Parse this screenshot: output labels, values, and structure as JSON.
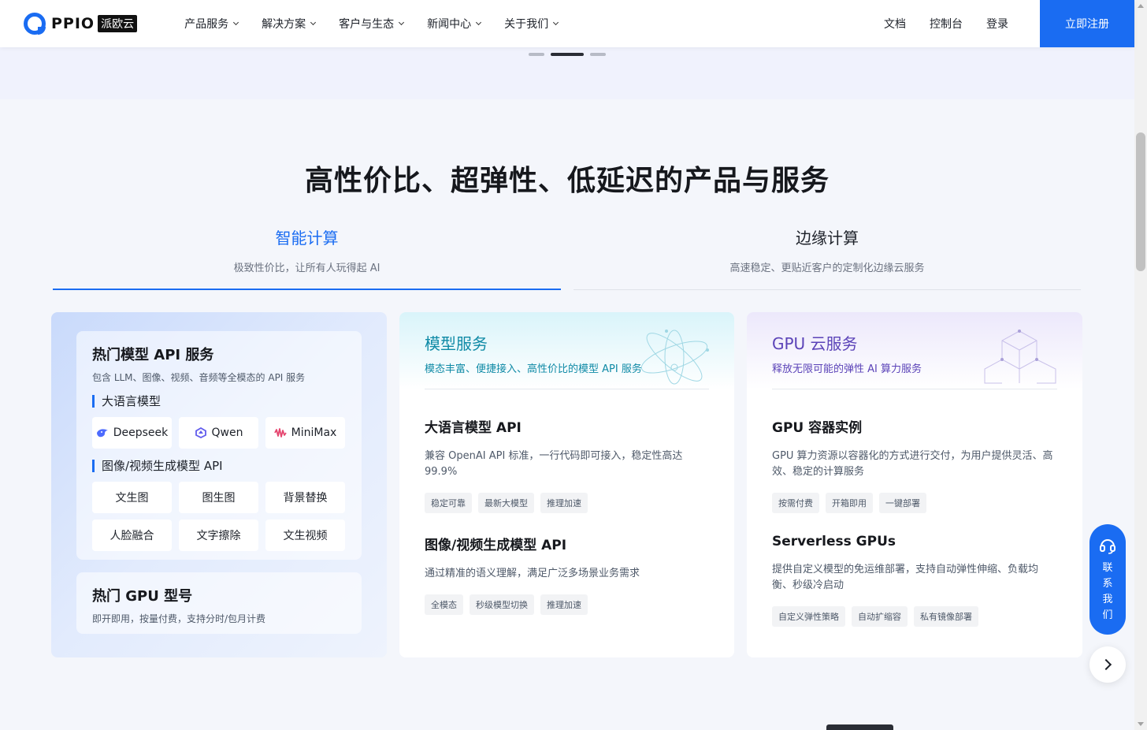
{
  "header": {
    "logo_text": "PPIO",
    "logo_cn": "派欧云",
    "nav": [
      "产品服务",
      "解决方案",
      "客户与生态",
      "新闻中心",
      "关于我们"
    ],
    "docs": "文档",
    "console": "控制台",
    "login": "登录",
    "signup": "立即注册"
  },
  "section": {
    "title": "高性价比、超弹性、低延迟的产品与服务"
  },
  "tabs": [
    {
      "title": "智能计算",
      "sub": "极致性价比，让所有人玩得起 AI"
    },
    {
      "title": "边缘计算",
      "sub": "高速稳定、更贴近客户的定制化边缘云服务"
    }
  ],
  "hot": {
    "title": "热门模型 API 服务",
    "sub": "包含 LLM、图像、视频、音频等全模态的 API 服务",
    "llm_label": "大语言模型",
    "llm_models": [
      "Deepseek",
      "Qwen",
      "MiniMax"
    ],
    "img_label": "图像/视频生成模型 API",
    "img_items": [
      "文生图",
      "图生图",
      "背景替换",
      "人脸融合",
      "文字擦除",
      "文生视频"
    ],
    "gpu_title": "热门 GPU 型号",
    "gpu_sub": "即开即用，按量付费，支持分时/包月计费"
  },
  "model_card": {
    "title": "模型服务",
    "sub": "模态丰富、便捷接入、高性价比的模型 API 服务",
    "services": [
      {
        "title": "大语言模型 API",
        "desc": "兼容 OpenAI API 标准，一行代码即可接入，稳定性高达 99.9%",
        "tags": [
          "稳定可靠",
          "最新大模型",
          "推理加速"
        ]
      },
      {
        "title": "图像/视频生成模型 API",
        "desc": "通过精准的语义理解，满足广泛多场景业务需求",
        "tags": [
          "全模态",
          "秒级模型切换",
          "推理加速"
        ]
      }
    ]
  },
  "gpu_card": {
    "title": "GPU 云服务",
    "sub": "释放无限可能的弹性 AI 算力服务",
    "services": [
      {
        "title": "GPU 容器实例",
        "desc": "GPU 算力资源以容器化的方式进行交付，为用户提供灵活、高效、稳定的计算服务",
        "tags": [
          "按需付费",
          "开箱即用",
          "一键部署"
        ]
      },
      {
        "title": "Serverless GPUs",
        "desc": "提供自定义模型的免运维部署，支持自动弹性伸缩、负载均衡、秒级冷启动",
        "tags": [
          "自定义弹性策略",
          "自动扩缩容",
          "私有镜像部署"
        ]
      }
    ]
  },
  "contact": {
    "label": "联系我们"
  },
  "colors": {
    "brand": "#1a6cf2",
    "model_accent": "#0f8aa6",
    "gpu_accent": "#5b43b8"
  }
}
